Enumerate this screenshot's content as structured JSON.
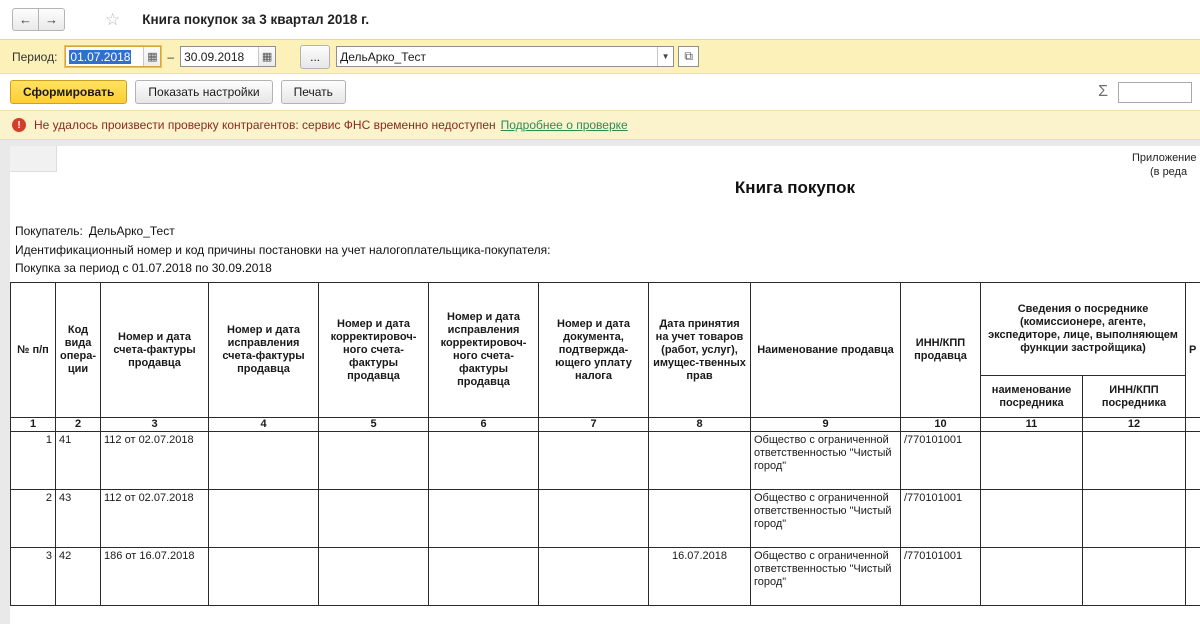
{
  "icons": {
    "back": "←",
    "forward": "→",
    "star": "☆",
    "calendar": "▦",
    "dropdown": "▼",
    "open": "⧉",
    "sigma": "Σ",
    "warning": "!"
  },
  "window": {
    "title": "Книга покупок за 3 квартал 2018 г."
  },
  "filters": {
    "period_label": "Период:",
    "date_from": "01.07.2018",
    "date_to": "30.09.2018",
    "dash": "–",
    "ellipsis_label": "...",
    "organization": "ДельАрко_Тест"
  },
  "actions": {
    "generate": "Сформировать",
    "settings": "Показать настройки",
    "print": "Печать"
  },
  "warning": {
    "message": "Не удалось произвести проверку контрагентов: сервис ФНС временно недоступен",
    "link": "Подробнее о проверке"
  },
  "report": {
    "appendix_line1": "Приложение N",
    "appendix_line2": "(в реда",
    "title": "Книга покупок",
    "buyer_label": "Покупатель:",
    "buyer_value": "ДельАрко_Тест",
    "id_line": "Идентификационный номер и код причины постановки на учет налогоплательщика-покупателя:",
    "period_line": "Покупка за период с 01.07.2018 по 30.09.2018"
  },
  "table": {
    "col_headers": [
      "№ п/п",
      "Код вида опера-ции",
      "Номер и дата счета-фактуры продавца",
      "Номер и дата исправления счета-фактуры продавца",
      "Номер и дата корректировоч-ного счета-фактуры продавца",
      "Номер и дата исправления корректировоч-ного счета-фактуры продавца",
      "Номер и дата документа, подтвержда-ющего уплату налога",
      "Дата принятия на учет  товаров (работ, услуг), имущес-твенных прав",
      "Наименование продавца",
      "ИНН/КПП продавца"
    ],
    "mediator": {
      "title": "Сведения о посреднике (комиссионере, агенте, экспедиторе, лице, выполняющем функции застройщика)",
      "sub_name": "наименование посредника",
      "sub_inn": "ИНН/КПП посредника"
    },
    "partial_col": "Р",
    "col_numbers": [
      "1",
      "2",
      "3",
      "4",
      "5",
      "6",
      "7",
      "8",
      "9",
      "10",
      "11",
      "12"
    ],
    "rows": [
      {
        "num": "1",
        "op_code": "41",
        "invoice": "112 от 02.07.2018",
        "invoice_fix": "",
        "adj_invoice": "",
        "adj_invoice_fix": "",
        "payment_doc": "",
        "accept_date": "",
        "seller": "Общество с ограниченной ответственностью \"Чистый город\"",
        "seller_inn": "/770101001",
        "mediator_name": "",
        "mediator_inn": "",
        "extra": ""
      },
      {
        "num": "2",
        "op_code": "43",
        "invoice": "112 от 02.07.2018",
        "invoice_fix": "",
        "adj_invoice": "",
        "adj_invoice_fix": "",
        "payment_doc": "",
        "accept_date": "",
        "seller": "Общество с ограниченной ответственностью \"Чистый город\"",
        "seller_inn": "/770101001",
        "mediator_name": "",
        "mediator_inn": "",
        "extra": ""
      },
      {
        "num": "3",
        "op_code": "42",
        "invoice": "186 от 16.07.2018",
        "invoice_fix": "",
        "adj_invoice": "",
        "adj_invoice_fix": "",
        "payment_doc": "",
        "accept_date": "16.07.2018",
        "seller": "Общество с ограниченной ответственностью \"Чистый город\"",
        "seller_inn": "/770101001",
        "mediator_name": "",
        "mediator_inn": "",
        "extra": ""
      }
    ]
  }
}
